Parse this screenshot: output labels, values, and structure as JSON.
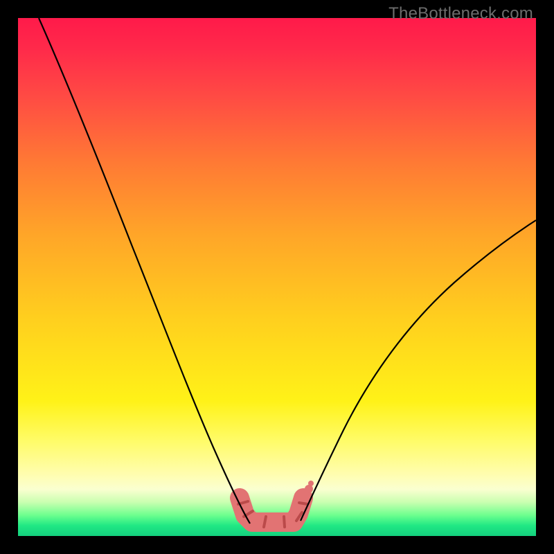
{
  "watermark": "TheBottleneck.com",
  "colors": {
    "gradient_top": "#ff1a4a",
    "gradient_mid": "#ffd21e",
    "gradient_bottom": "#14d07e",
    "curve": "#000000",
    "worm_fill": "#e27373",
    "worm_line": "#bb4a4a",
    "frame": "#000000"
  },
  "chart_data": {
    "type": "line",
    "title": "",
    "xlabel": "",
    "ylabel": "",
    "xlim": [
      0,
      100
    ],
    "ylim": [
      0,
      100
    ],
    "grid": false,
    "legend": false,
    "note": "Two black curves descending into a minimum near the center-bottom; a pink 'worm' marks the flat bottom region between them. Background is a vertical heat gradient from red (top) to green (bottom). Values below are pixel-estimated from the figure.",
    "series": [
      {
        "name": "left_curve",
        "x": [
          4,
          10,
          16,
          22,
          28,
          33,
          37,
          40,
          42,
          43.5,
          44.5,
          45
        ],
        "y": [
          100,
          89,
          77,
          63,
          49,
          36,
          24,
          14,
          8,
          4.5,
          3,
          2.5
        ]
      },
      {
        "name": "right_curve",
        "x": [
          54.5,
          56,
          58,
          61,
          65,
          72,
          80,
          88,
          94,
          100
        ],
        "y": [
          3,
          5,
          9,
          15,
          23,
          34,
          44,
          52,
          57,
          61
        ]
      }
    ],
    "annotations": [
      {
        "name": "worm_minimum_region",
        "x_start": 42,
        "x_end": 55,
        "y": 2,
        "description": "pink rounded sausage shape sitting at the valley between the two curves"
      }
    ]
  }
}
